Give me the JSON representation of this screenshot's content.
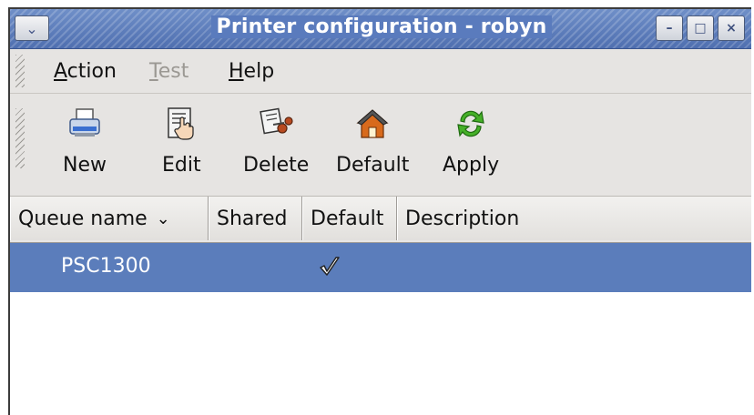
{
  "window": {
    "title": "Printer configuration - robyn",
    "controls": {
      "minimize": "–",
      "maximize": "□",
      "close": "×",
      "menu": "⌄"
    }
  },
  "menubar": {
    "items": [
      {
        "label": "Action",
        "accel": "A",
        "rest": "ction",
        "enabled": true
      },
      {
        "label": "Test",
        "accel": "T",
        "rest": "est",
        "enabled": false
      },
      {
        "label": "Help",
        "accel": "H",
        "rest": "elp",
        "enabled": true
      }
    ]
  },
  "toolbar": {
    "buttons": [
      {
        "label": "New",
        "icon": "printer-icon"
      },
      {
        "label": "Edit",
        "icon": "edit-document-icon"
      },
      {
        "label": "Delete",
        "icon": "scissors-icon"
      },
      {
        "label": "Default",
        "icon": "home-icon"
      },
      {
        "label": "Apply",
        "icon": "refresh-icon"
      }
    ]
  },
  "table": {
    "columns": [
      "Queue name",
      "Shared",
      "Default",
      "Description"
    ],
    "sort_indicator": "⌄",
    "rows": [
      {
        "queue_name": "PSC1300",
        "shared": "",
        "default": true,
        "description": ""
      }
    ]
  },
  "colors": {
    "titlebar": "#5a7bbd",
    "selection": "#5b7dbb",
    "window_bg": "#e6e4e2"
  }
}
